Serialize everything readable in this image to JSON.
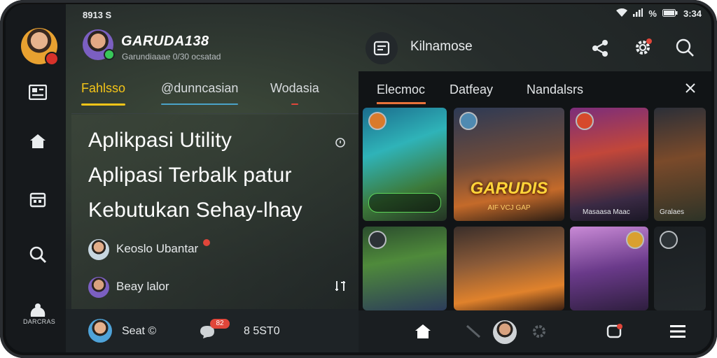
{
  "status": {
    "time_left": "8913 S",
    "time_right": "3:34",
    "battery": "%"
  },
  "rail": {
    "items": [
      "news-icon",
      "home-icon",
      "calendar-icon",
      "search-icon",
      "games-icon"
    ],
    "label": "DARCRAS"
  },
  "header": {
    "brand": "GARUDA138",
    "subtitle": "Garundiaaae 0/30 ocsatad"
  },
  "tabs_left": [
    {
      "label": "Fahlsso",
      "active": true,
      "color": "#f5c518"
    },
    {
      "label": "@dunncasian",
      "active": false,
      "color": "#4aa3c8"
    },
    {
      "label": "Wodasia",
      "active": false,
      "color": "#e0463a"
    }
  ],
  "headlines": [
    "Aplikpasi Utility",
    "Aplipasi Terbalk patur",
    "Kebutukan Sehay-lhay"
  ],
  "authors": [
    {
      "name": "Keoslo Ubantar"
    },
    {
      "name": "Beay lalor"
    }
  ],
  "bottom_left": {
    "user": "Seat ©",
    "count": "8 5ST0",
    "badge": "82"
  },
  "right": {
    "title": "Kilnamose",
    "tabs": [
      {
        "label": "Elecmoc",
        "active": true,
        "color": "#e8723a"
      },
      {
        "label": "Datfeay",
        "active": false
      },
      {
        "label": "Nandalsrs",
        "active": false
      }
    ],
    "tiles": [
      {
        "kind": "fantasy-map",
        "caption": ""
      },
      {
        "kind": "hero-rifle",
        "title": "GARUDIS",
        "caption": "AIF VCJ GAP"
      },
      {
        "kind": "female-warrior",
        "caption": "Masaasa Maac"
      },
      {
        "kind": "soldier",
        "caption": "Gralaes"
      },
      {
        "kind": "forest",
        "caption": ""
      },
      {
        "kind": "squad-fire",
        "caption": ""
      },
      {
        "kind": "purple-knight",
        "caption": ""
      },
      {
        "kind": "dark",
        "caption": ""
      }
    ]
  },
  "colors": {
    "accent_yellow": "#f5c518",
    "accent_orange": "#e8723a",
    "alert_red": "#e0463a"
  }
}
